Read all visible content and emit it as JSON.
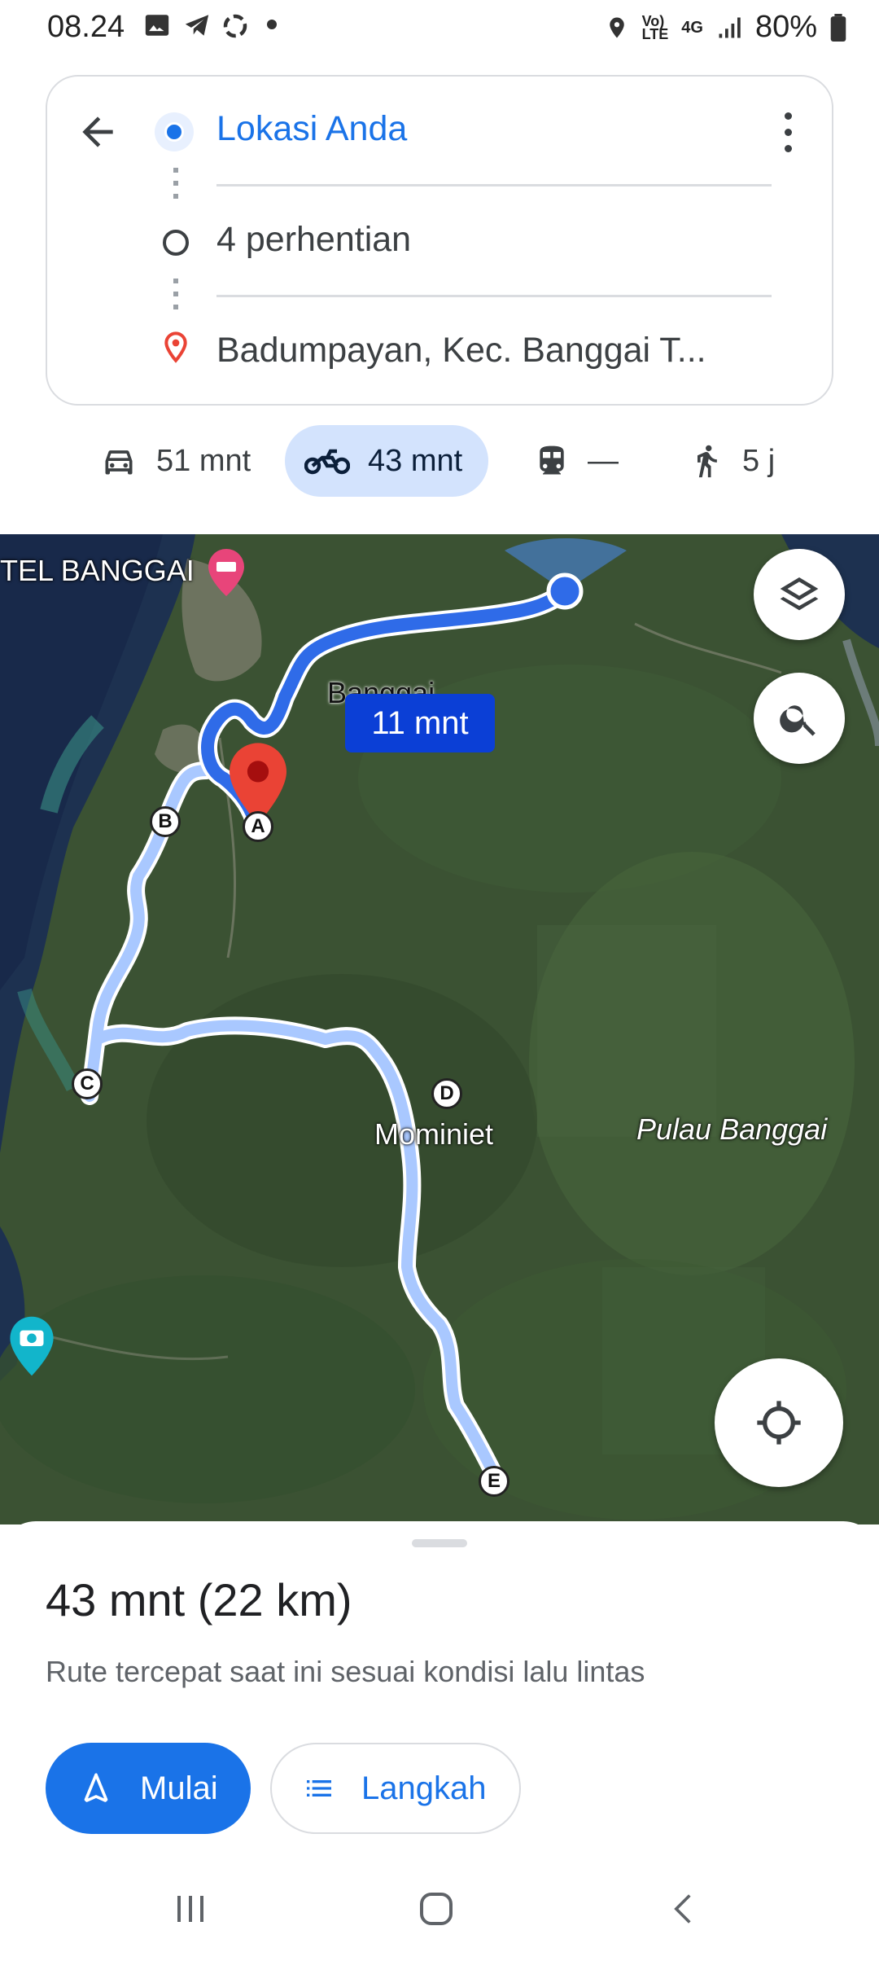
{
  "status": {
    "time": "08.24",
    "battery": "80%",
    "network": "4G"
  },
  "route": {
    "origin": "Lokasi Anda",
    "stops": "4 perhentian",
    "destination": "Badumpayan, Kec. Banggai T..."
  },
  "modes": [
    {
      "icon": "car-icon",
      "label": "51 mnt"
    },
    {
      "icon": "motorcycle-icon",
      "label": "43 mnt",
      "selected": true
    },
    {
      "icon": "transit-icon",
      "label": "—"
    },
    {
      "icon": "walk-icon",
      "label": "5 j"
    }
  ],
  "map": {
    "poi_hotel": "TEL BANGGAI",
    "town_banggai": "Banggai",
    "eta_badge": "11 mnt",
    "town_mominiet": "Mominiet",
    "island": "Pulau Banggai",
    "stops": [
      "A",
      "B",
      "C",
      "D",
      "E"
    ]
  },
  "summary": {
    "title": "43 mnt (22 km)",
    "subtitle": "Rute tercepat saat ini sesuai kondisi lalu lintas"
  },
  "buttons": {
    "start": "Mulai",
    "steps": "Langkah"
  },
  "colors": {
    "accent": "#1a73e8",
    "route": "#a9c8ff",
    "route_active": "#2f6be8",
    "pin": "#ea4335"
  }
}
